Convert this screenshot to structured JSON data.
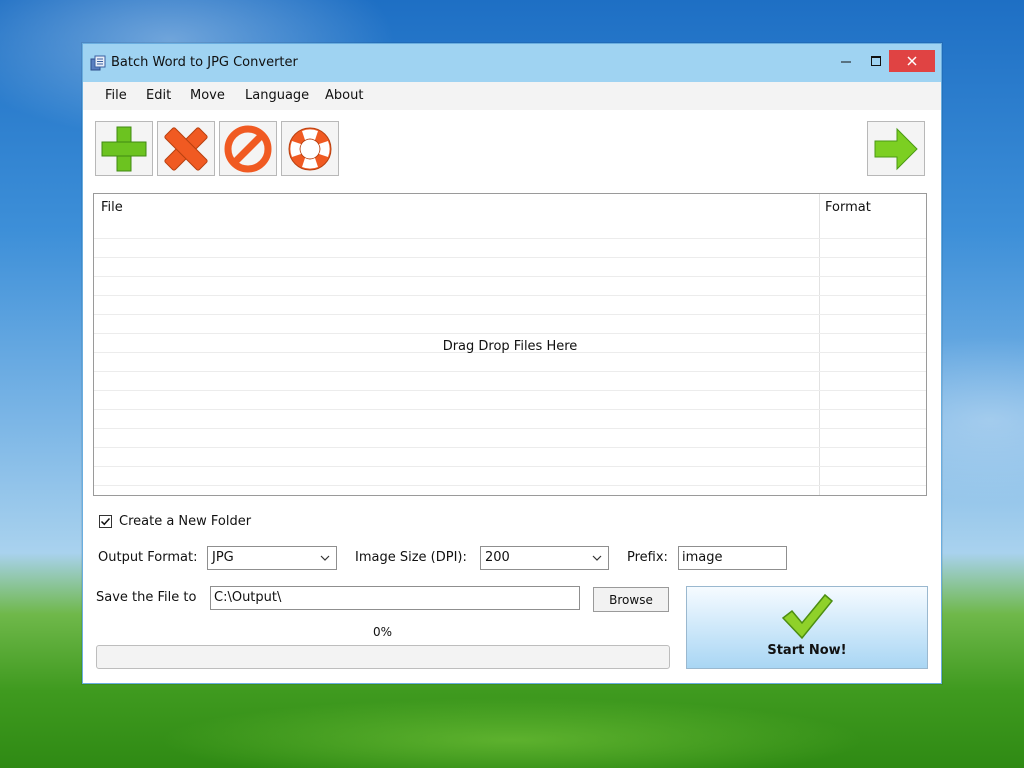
{
  "window": {
    "title": "Batch Word to JPG Converter"
  },
  "menu": {
    "items": [
      "File",
      "Edit",
      "Move",
      "Language",
      "About"
    ]
  },
  "toolbar": {
    "add_icon": "plus-icon",
    "remove_icon": "x-icon",
    "clear_icon": "prohibit-icon",
    "help_icon": "lifebuoy-icon",
    "next_icon": "arrow-right-icon"
  },
  "file_list": {
    "columns": [
      "File",
      "Format"
    ],
    "placeholder": "Drag  Drop Files Here"
  },
  "options": {
    "create_folder_label": "Create a New Folder",
    "create_folder_checked": true,
    "output_format_label": "Output Format:",
    "output_format_value": "JPG",
    "image_size_label": "Image Size (DPI):",
    "image_size_value": "200",
    "prefix_label": "Prefix:",
    "prefix_value": "image",
    "save_to_label": "Save the File to",
    "save_to_value": "C:\\Output\\",
    "browse_label": "Browse"
  },
  "progress": {
    "label": "0%",
    "value": 0
  },
  "start": {
    "label": "Start Now!"
  },
  "colors": {
    "titlebar": "#9fd3f2",
    "close": "#e04343",
    "green": "#3fae3f",
    "orange": "#f05a22"
  }
}
